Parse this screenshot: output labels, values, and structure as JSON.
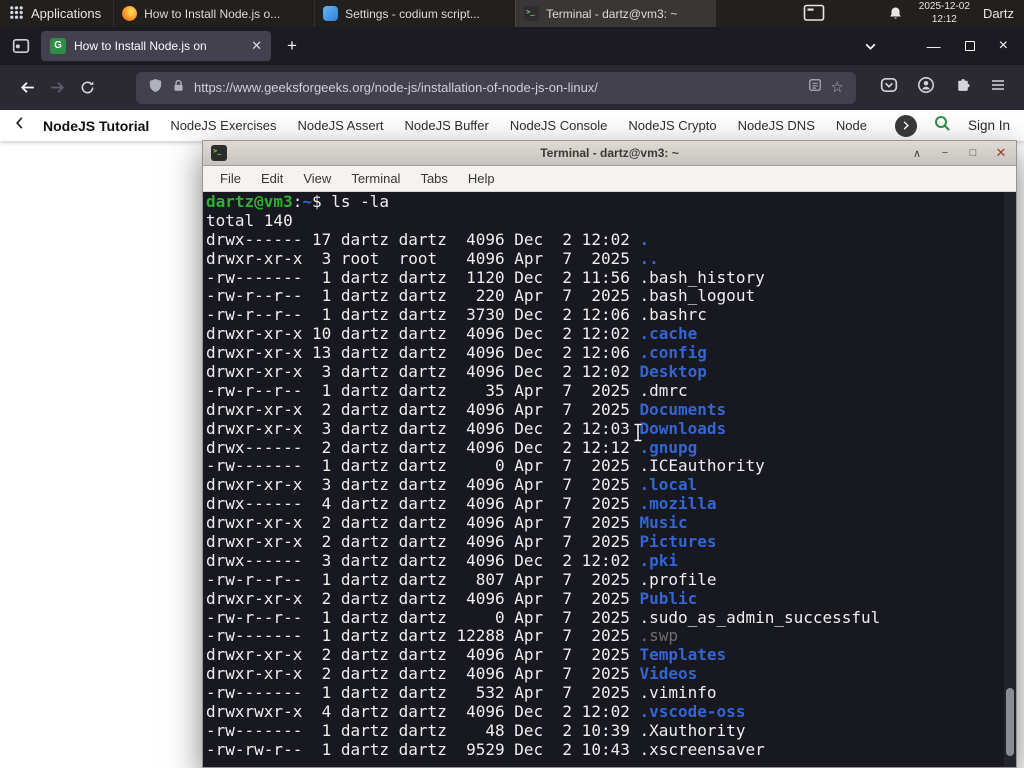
{
  "colors": {
    "dir_blue": "#3465d4",
    "prompt_green": "#30b030",
    "dim_gray": "#6f6f6f",
    "gfg_green": "#2f8d46",
    "terminal_bg": "#181820"
  },
  "panel": {
    "applications_label": "Applications",
    "windows": [
      {
        "title": "How to Install Node.js o...",
        "icon": "firefox",
        "state": ""
      },
      {
        "title": "Settings - codium script...",
        "icon": "codium",
        "state": ""
      },
      {
        "title": "Terminal - dartz@vm3: ~",
        "icon": "terminal",
        "state": "active"
      }
    ],
    "clock_date": "2025-12-02",
    "clock_time": "12:12",
    "user": "Dartz"
  },
  "browser": {
    "tab": {
      "title": "How to Install Node.js on",
      "favicon_letter": "G"
    },
    "url": "https://www.geeksforgeeks.org/node-js/installation-of-node-js-on-linux/",
    "sitenav": {
      "items": [
        {
          "label": "NodeJS Tutorial",
          "cls": "primary"
        },
        {
          "label": "NodeJS Exercises",
          "cls": ""
        },
        {
          "label": "NodeJS Assert",
          "cls": ""
        },
        {
          "label": "NodeJS Buffer",
          "cls": ""
        },
        {
          "label": "NodeJS Console",
          "cls": ""
        },
        {
          "label": "NodeJS Crypto",
          "cls": ""
        },
        {
          "label": "NodeJS DNS",
          "cls": ""
        },
        {
          "label": "Node",
          "cls": ""
        }
      ],
      "sign_in_label": "Sign In"
    }
  },
  "terminal": {
    "title": "Terminal - dartz@vm3: ~",
    "menu": [
      "File",
      "Edit",
      "View",
      "Terminal",
      "Tabs",
      "Help"
    ],
    "prompt_user_host": "dartz@vm3",
    "prompt_sep": ":",
    "prompt_path": "~",
    "prompt_symbol": "$ ",
    "command": "ls -la",
    "total_line": "total 140",
    "rows": [
      {
        "pre": "drwx------ 17 dartz dartz  4096 Dec  2 12:02 ",
        "name": ".",
        "c": "dir"
      },
      {
        "pre": "drwxr-xr-x  3 root  root   4096 Apr  7  2025 ",
        "name": "..",
        "c": "dir"
      },
      {
        "pre": "-rw-------  1 dartz dartz  1120 Dec  2 11:56 ",
        "name": ".bash_history",
        "c": "file"
      },
      {
        "pre": "-rw-r--r--  1 dartz dartz   220 Apr  7  2025 ",
        "name": ".bash_logout",
        "c": "file"
      },
      {
        "pre": "-rw-r--r--  1 dartz dartz  3730 Dec  2 12:06 ",
        "name": ".bashrc",
        "c": "file"
      },
      {
        "pre": "drwxr-xr-x 10 dartz dartz  4096 Dec  2 12:02 ",
        "name": ".cache",
        "c": "dir"
      },
      {
        "pre": "drwxr-xr-x 13 dartz dartz  4096 Dec  2 12:06 ",
        "name": ".config",
        "c": "dir"
      },
      {
        "pre": "drwxr-xr-x  3 dartz dartz  4096 Dec  2 12:02 ",
        "name": "Desktop",
        "c": "dir"
      },
      {
        "pre": "-rw-r--r--  1 dartz dartz    35 Apr  7  2025 ",
        "name": ".dmrc",
        "c": "file"
      },
      {
        "pre": "drwxr-xr-x  2 dartz dartz  4096 Apr  7  2025 ",
        "name": "Documents",
        "c": "dir"
      },
      {
        "pre": "drwxr-xr-x  3 dartz dartz  4096 Dec  2 12:03 ",
        "name": "Downloads",
        "c": "dir"
      },
      {
        "pre": "drwx------  2 dartz dartz  4096 Dec  2 12:12 ",
        "name": ".gnupg",
        "c": "dir"
      },
      {
        "pre": "-rw-------  1 dartz dartz     0 Apr  7  2025 ",
        "name": ".ICEauthority",
        "c": "file"
      },
      {
        "pre": "drwxr-xr-x  3 dartz dartz  4096 Apr  7  2025 ",
        "name": ".local",
        "c": "dir"
      },
      {
        "pre": "drwx------  4 dartz dartz  4096 Apr  7  2025 ",
        "name": ".mozilla",
        "c": "dir"
      },
      {
        "pre": "drwxr-xr-x  2 dartz dartz  4096 Apr  7  2025 ",
        "name": "Music",
        "c": "dir"
      },
      {
        "pre": "drwxr-xr-x  2 dartz dartz  4096 Apr  7  2025 ",
        "name": "Pictures",
        "c": "dir"
      },
      {
        "pre": "drwx------  3 dartz dartz  4096 Dec  2 12:02 ",
        "name": ".pki",
        "c": "dir"
      },
      {
        "pre": "-rw-r--r--  1 dartz dartz   807 Apr  7  2025 ",
        "name": ".profile",
        "c": "file"
      },
      {
        "pre": "drwxr-xr-x  2 dartz dartz  4096 Apr  7  2025 ",
        "name": "Public",
        "c": "dir"
      },
      {
        "pre": "-rw-r--r--  1 dartz dartz     0 Apr  7  2025 ",
        "name": ".sudo_as_admin_successful",
        "c": "file"
      },
      {
        "pre": "-rw-------  1 dartz dartz 12288 Apr  7  2025 ",
        "name": ".swp",
        "c": "dim"
      },
      {
        "pre": "drwxr-xr-x  2 dartz dartz  4096 Apr  7  2025 ",
        "name": "Templates",
        "c": "dir"
      },
      {
        "pre": "drwxr-xr-x  2 dartz dartz  4096 Apr  7  2025 ",
        "name": "Videos",
        "c": "dir"
      },
      {
        "pre": "-rw-------  1 dartz dartz   532 Apr  7  2025 ",
        "name": ".viminfo",
        "c": "file"
      },
      {
        "pre": "drwxrwxr-x  4 dartz dartz  4096 Dec  2 12:02 ",
        "name": ".vscode-oss",
        "c": "dir"
      },
      {
        "pre": "-rw-------  1 dartz dartz    48 Dec  2 10:39 ",
        "name": ".Xauthority",
        "c": "file"
      },
      {
        "pre": "-rw-rw-r--  1 dartz dartz  9529 Dec  2 10:43 ",
        "name": ".xscreensaver",
        "c": "file"
      }
    ]
  }
}
